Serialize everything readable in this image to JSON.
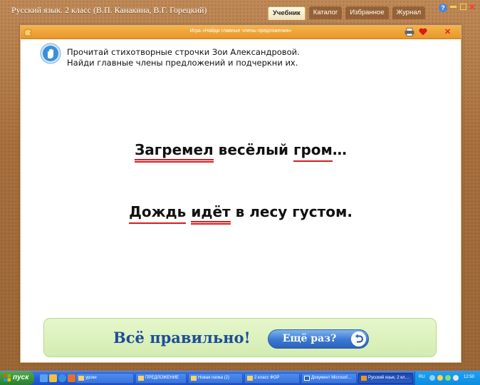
{
  "app": {
    "title": "Русский язык. 2 класс (В.П. Канакина, В.Г. Горецкий)",
    "tabs": [
      {
        "label": "Учебник",
        "active": true
      },
      {
        "label": "Каталог",
        "active": false
      },
      {
        "label": "Избранное",
        "active": false
      },
      {
        "label": "Журнал",
        "active": false
      }
    ],
    "help_label": "?"
  },
  "panel": {
    "title": "Игра «Найди главные члены предложения»",
    "instruction_line1": "Прочитай стихотворные строчки Зои Александровой.",
    "instruction_line2": "Найди главные члены предложений и подчеркни их."
  },
  "sentences": [
    {
      "words": [
        {
          "text": "Загремел",
          "role": "predicate"
        },
        {
          "text": "весёлый",
          "role": "none"
        },
        {
          "text": "гром",
          "role": "subject"
        },
        {
          "text": "…",
          "role": "none"
        }
      ]
    },
    {
      "words": [
        {
          "text": "Дождь",
          "role": "subject"
        },
        {
          "text": "идёт",
          "role": "predicate"
        },
        {
          "text": "в лесу густом.",
          "role": "none"
        }
      ]
    }
  ],
  "result": {
    "message": "Всё правильно!",
    "retry_label": "Ещё раз?"
  },
  "taskbar": {
    "start_label": "пуск",
    "buttons": [
      {
        "label": "уроки",
        "active": false
      },
      {
        "label": "ПРЕДЛОЖЕНИЕ",
        "active": false
      },
      {
        "label": "Новая папка (2)",
        "active": false
      },
      {
        "label": "2 класс ФОР",
        "active": false
      },
      {
        "label": "Документ Microsof…",
        "active": false
      },
      {
        "label": "Русский язык. 2 кл…",
        "active": true
      }
    ],
    "language": "RU",
    "clock": "12:50"
  },
  "colors": {
    "frame": "#b07848",
    "panel_header": "#f0a43a",
    "underline": "#d71c1c",
    "result_text": "#1f4c9a",
    "result_bg": "#dff3c2",
    "button_blue": "#3a78d2",
    "taskbar": "#245edb"
  }
}
